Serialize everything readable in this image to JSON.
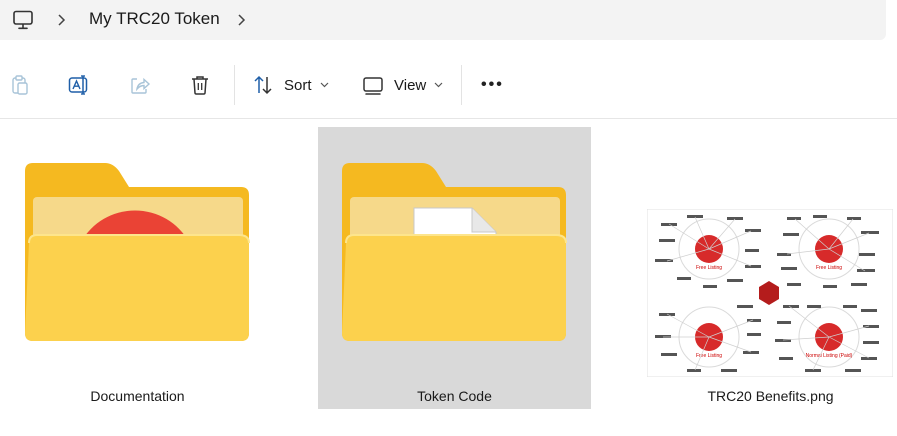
{
  "breadcrumb": {
    "root_icon": "pc-icon",
    "current": "My TRC20 Token"
  },
  "toolbar": {
    "copy_icon": "clipboard-icon",
    "rename_icon": "rename-icon",
    "share_icon": "share-icon",
    "delete_icon": "trash-icon",
    "sort_label": "Sort",
    "view_label": "View",
    "more_label": "•••"
  },
  "items": [
    {
      "name": "Documentation",
      "kind": "folder",
      "overlay": "chrome-icon",
      "selected": false
    },
    {
      "name": "Token Code",
      "kind": "folder",
      "overlay": "document-icon",
      "selected": true
    },
    {
      "name": "TRC20 Benefits.png",
      "kind": "image",
      "selected": false
    }
  ],
  "image_text": {
    "q1_title": "Free Listing",
    "q2_title": "Free Listing",
    "q3_title": "Free Listing",
    "q4_title": "Normal Listing (Paid)"
  },
  "colors": {
    "folder_back": "#f5b920",
    "folder_front": "#fcd14d",
    "selected_bg": "#d9d9d9",
    "accent": "#0067c0"
  }
}
